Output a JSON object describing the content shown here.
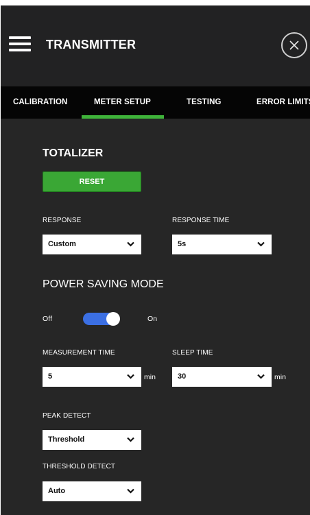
{
  "header": {
    "title": "TRANSMITTER"
  },
  "tabs": [
    {
      "label": "CALIBRATION"
    },
    {
      "label": "METER SETUP"
    },
    {
      "label": "TESTING"
    },
    {
      "label": "ERROR LIMITS"
    }
  ],
  "active_tab": "METER SETUP",
  "totalizer": {
    "title": "TOTALIZER",
    "reset_label": "RESET"
  },
  "response": {
    "label": "RESPONSE",
    "value": "Custom"
  },
  "response_time": {
    "label": "RESPONSE TIME",
    "value": "5s"
  },
  "power_saving": {
    "title": "POWER SAVING MODE",
    "off_label": "Off",
    "on_label": "On",
    "enabled": true
  },
  "measurement_time": {
    "label": "MEASUREMENT TIME",
    "value": "5",
    "unit": "min"
  },
  "sleep_time": {
    "label": "SLEEP TIME",
    "value": "30",
    "unit": "min"
  },
  "peak_detect": {
    "label": "PEAK DETECT",
    "value": "Threshold"
  },
  "threshold_detect": {
    "label": "THRESHOLD DETECT",
    "value": "Auto"
  },
  "colors": {
    "accent_green": "#3aa735",
    "toggle_blue": "#3b6fe3",
    "header_bg": "#222223",
    "panel_bg": "#262626"
  }
}
